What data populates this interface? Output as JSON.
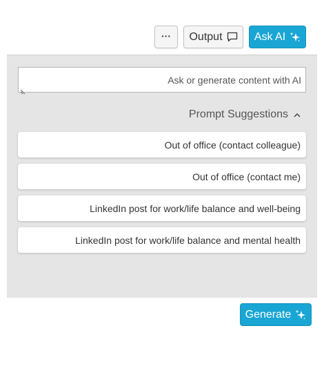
{
  "toolbar": {
    "more_label": "···",
    "output_label": "Output",
    "output_icon": "chat-bubble-icon",
    "ask_ai_label": "Ask AI",
    "ask_ai_icon": "sparkle-icon",
    "accent_color": "#1aa6d4"
  },
  "prompt": {
    "placeholder": "Ask or generate content with AI",
    "value": ""
  },
  "suggestions": {
    "header": "Prompt Suggestions",
    "toggle_icon": "chevron-up-icon",
    "items": [
      "Out of office (contact colleague)",
      "Out of office (contact me)",
      "LinkedIn post for work/life balance and well-being",
      "LinkedIn post for work/life balance and mental health"
    ]
  },
  "footer": {
    "generate_label": "Generate",
    "generate_icon": "sparkle-icon"
  }
}
